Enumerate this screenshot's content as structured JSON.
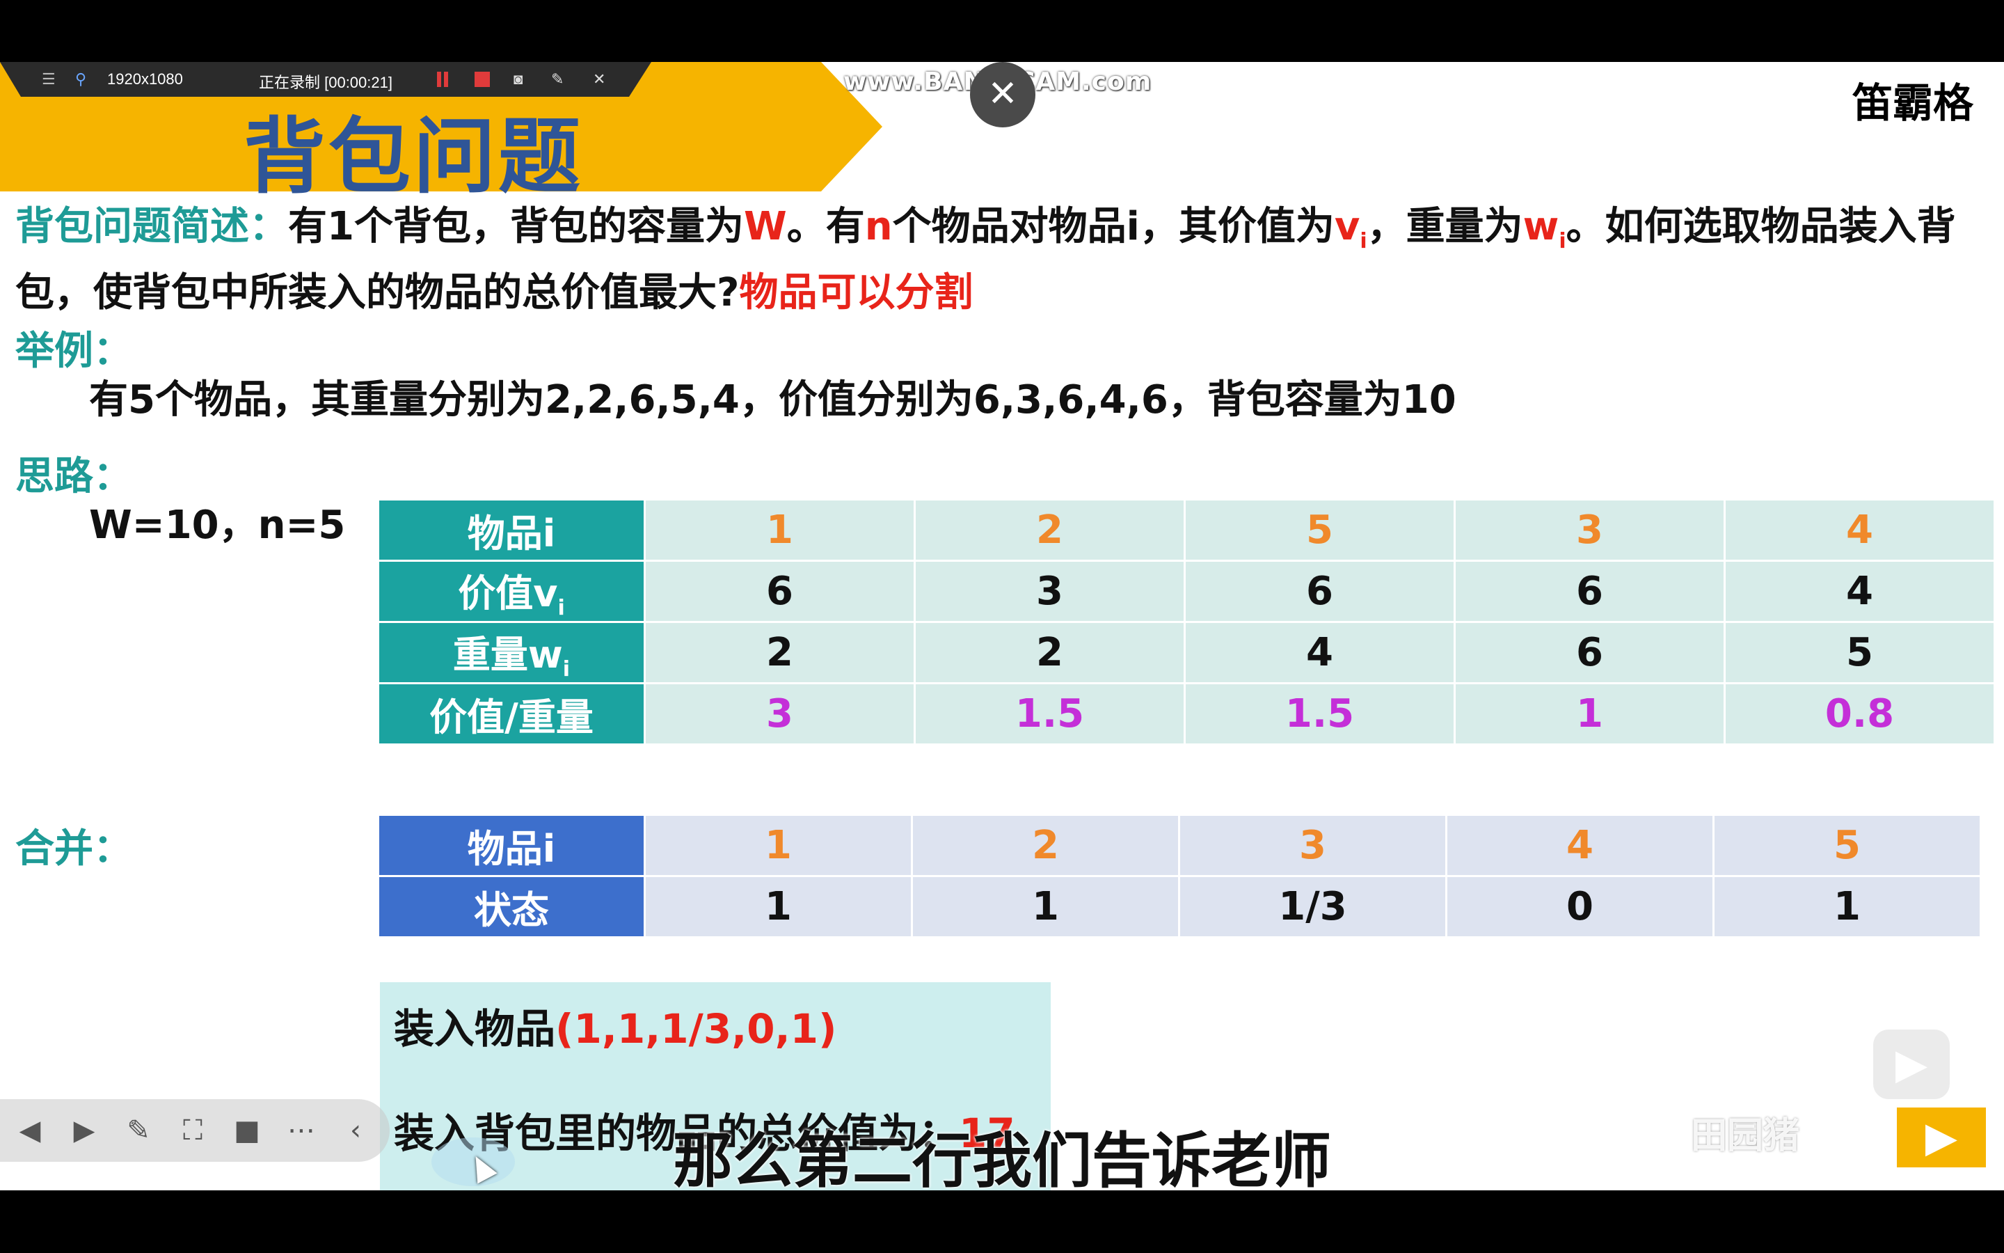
{
  "recorder": {
    "resolution": "1920x1080",
    "status": "正在录制 [00:00:21]",
    "watermark": "www.BANDICAM.com"
  },
  "slide": {
    "title": "背包问题",
    "author": "笛霸格",
    "desc": {
      "label": "背包问题简述：",
      "p1": "有1个背包，背包的容量为",
      "W": "W",
      "p2": "。有",
      "n": "n",
      "p3": "个物品对物品i，其价值为",
      "v": "v",
      "vsub": "i",
      "p4": "，重量为",
      "w": "w",
      "wsub": "i",
      "p5": "。如何选取物品装入背包，使背包中所装入的物品的总价值最大?",
      "highlight": "物品可以分割"
    },
    "example_label": "举例：",
    "example_text": "有5个物品，其重量分别为2,2,6,5,4，价值分别为6,3,6,4,6，背包容量为10",
    "idea_label": "思路：",
    "params": "W=10，n=5",
    "merge_label": "合并：",
    "table1": {
      "headers": [
        "物品i",
        "价值v",
        "重量w",
        "价值/重量"
      ],
      "header_sub": "i",
      "items": [
        "1",
        "2",
        "5",
        "3",
        "4"
      ],
      "values": [
        "6",
        "3",
        "6",
        "6",
        "4"
      ],
      "weights": [
        "2",
        "2",
        "4",
        "6",
        "5"
      ],
      "ratios": [
        "3",
        "1.5",
        "1.5",
        "1",
        "0.8"
      ]
    },
    "table2": {
      "headers": [
        "物品i",
        "状态"
      ],
      "items": [
        "1",
        "2",
        "3",
        "4",
        "5"
      ],
      "states": [
        "1",
        "1",
        "1/3",
        "0",
        "1"
      ]
    },
    "result": {
      "line1_label": "装入物品",
      "line1_value": "(1,1,1/3,0,1)",
      "line2_label": "装入背包里的物品的总价值为：",
      "line2_value": "17"
    }
  },
  "subtitle": "那么第二行我们告诉老师",
  "overlay": {
    "bili_watermark": "田园猪"
  }
}
